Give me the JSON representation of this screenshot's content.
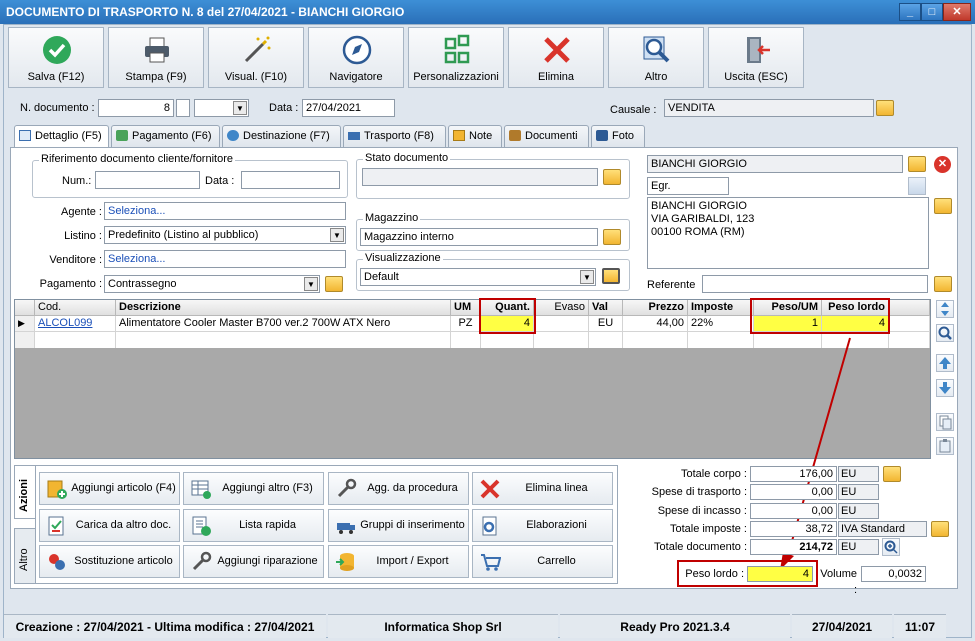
{
  "window": {
    "title": "DOCUMENTO DI TRASPORTO N. 8 del 27/04/2021 - BIANCHI GIORGIO"
  },
  "toolbar": [
    {
      "label": "Salva (F12)",
      "icon": "check-icon",
      "name": "save-button"
    },
    {
      "label": "Stampa (F9)",
      "icon": "printer-icon",
      "name": "print-button"
    },
    {
      "label": "Visual. (F10)",
      "icon": "magic-wand-icon",
      "name": "preview-button"
    },
    {
      "label": "Navigatore",
      "icon": "compass-icon",
      "name": "navigator-button"
    },
    {
      "label": "Personalizzazioni",
      "icon": "grid-squares-icon",
      "name": "customize-button"
    },
    {
      "label": "Elimina",
      "icon": "x-icon",
      "name": "delete-button"
    },
    {
      "label": "Altro",
      "icon": "magnifier-icon",
      "name": "other-button"
    },
    {
      "label": "Uscita (ESC)",
      "icon": "exit-door-icon",
      "name": "exit-button"
    }
  ],
  "header": {
    "doc_number_label": "N. documento :",
    "doc_number": "8",
    "date_label": "Data :",
    "date": "27/04/2021",
    "causale_label": "Causale :",
    "causale": "VENDITA"
  },
  "tabs": [
    {
      "label": "Dettaglio (F5)",
      "icon": "list-icon"
    },
    {
      "label": "Pagamento (F6)",
      "icon": "money-icon"
    },
    {
      "label": "Destinazione (F7)",
      "icon": "globe-icon"
    },
    {
      "label": "Trasporto (F8)",
      "icon": "truck-icon"
    },
    {
      "label": "Note",
      "icon": "note-icon"
    },
    {
      "label": "Documenti",
      "icon": "briefcase-icon"
    },
    {
      "label": "Foto",
      "icon": "camera-icon"
    }
  ],
  "riferimento": {
    "title": "Riferimento documento cliente/fornitore",
    "num_label": "Num.:",
    "num": "",
    "data_label": "Data :",
    "data": ""
  },
  "fields": {
    "agente_label": "Agente :",
    "agente": "Seleziona...",
    "listino_label": "Listino :",
    "listino": "Predefinito (Listino al pubblico)",
    "venditore_label": "Venditore :",
    "venditore": "Seleziona...",
    "pagamento_label": "Pagamento :",
    "pagamento": "Contrassegno"
  },
  "stato": {
    "title": "Stato documento",
    "value": ""
  },
  "magazzino": {
    "title": "Magazzino",
    "value": "Magazzino interno"
  },
  "visualizzazione": {
    "title": "Visualizzazione",
    "value": "Default"
  },
  "cliente": {
    "name": "BIANCHI GIORGIO",
    "title": "Egr.",
    "address_lines": [
      "BIANCHI GIORGIO",
      "VIA GARIBALDI, 123",
      "00100 ROMA (RM)"
    ],
    "referente_label": "Referente",
    "referente": ""
  },
  "grid": {
    "headers": {
      "cod": "Cod.",
      "desc": "Descrizione",
      "um": "UM",
      "quant": "Quant.",
      "evaso": "Evaso",
      "val": "Val",
      "prezzo": "Prezzo",
      "imposte": "Imposte",
      "pesoum": "Peso/UM",
      "pesolordo": "Peso lordo"
    },
    "rows": [
      {
        "cod": "ALCOL099",
        "desc": "Alimentatore Cooler Master B700 ver.2 700W ATX Nero",
        "um": "PZ",
        "quant": "4",
        "evaso": "",
        "val": "EU",
        "prezzo": "44,00",
        "imposte": "22%",
        "pesoum": "1",
        "pesolordo": "4"
      }
    ]
  },
  "azioni": {
    "tab_azioni": "Azioni",
    "tab_altro": "Altro",
    "buttons": [
      {
        "label": "Aggiungi articolo (F4)",
        "icon": "add-item-icon",
        "name": "add-article-button"
      },
      {
        "label": "Aggiungi altro (F3)",
        "icon": "add-other-icon",
        "name": "add-other-button"
      },
      {
        "label": "Agg. da procedura",
        "icon": "wrench-icon",
        "name": "add-from-procedure-button"
      },
      {
        "label": "Elimina linea",
        "icon": "delete-line-icon",
        "name": "delete-line-button"
      },
      {
        "label": "Carica da altro doc.",
        "icon": "load-doc-icon",
        "name": "load-from-doc-button"
      },
      {
        "label": "Lista rapida",
        "icon": "quick-list-icon",
        "name": "quick-list-button"
      },
      {
        "label": "Gruppi di inserimento",
        "icon": "truck-add-icon",
        "name": "insert-groups-button"
      },
      {
        "label": "Elaborazioni",
        "icon": "gear-doc-icon",
        "name": "processing-button"
      },
      {
        "label": "Sostituzione articolo",
        "icon": "swap-icon",
        "name": "replace-article-button"
      },
      {
        "label": "Aggiungi riparazione",
        "icon": "repair-icon",
        "name": "add-repair-button"
      },
      {
        "label": "Import / Export",
        "icon": "database-icon",
        "name": "import-export-button"
      },
      {
        "label": "Carrello",
        "icon": "cart-icon",
        "name": "cart-button"
      }
    ]
  },
  "totali": {
    "corpo_label": "Totale corpo :",
    "corpo": "176,00",
    "corpo_u": "EU",
    "trasporto_label": "Spese di trasporto :",
    "trasporto": "0,00",
    "trasporto_u": "EU",
    "incasso_label": "Spese di incasso :",
    "incasso": "0,00",
    "incasso_u": "EU",
    "imposte_label": "Totale imposte :",
    "imposte": "38,72",
    "imposte_u": "IVA Standard",
    "documento_label": "Totale documento :",
    "documento": "214,72",
    "documento_u": "EU",
    "peso_label": "Peso lordo :",
    "peso": "4",
    "volume_label": "Volume :",
    "volume": "0,0032"
  },
  "status": {
    "creazione": "Creazione : 27/04/2021 - Ultima modifica : 27/04/2021",
    "company": "Informatica Shop Srl",
    "version": "Ready Pro 2021.3.4",
    "date": "27/04/2021",
    "time": "11:07"
  },
  "colors": {
    "title_bar": "#2f7cc6",
    "highlight": "#ffff44",
    "annotation": "#c00000"
  }
}
